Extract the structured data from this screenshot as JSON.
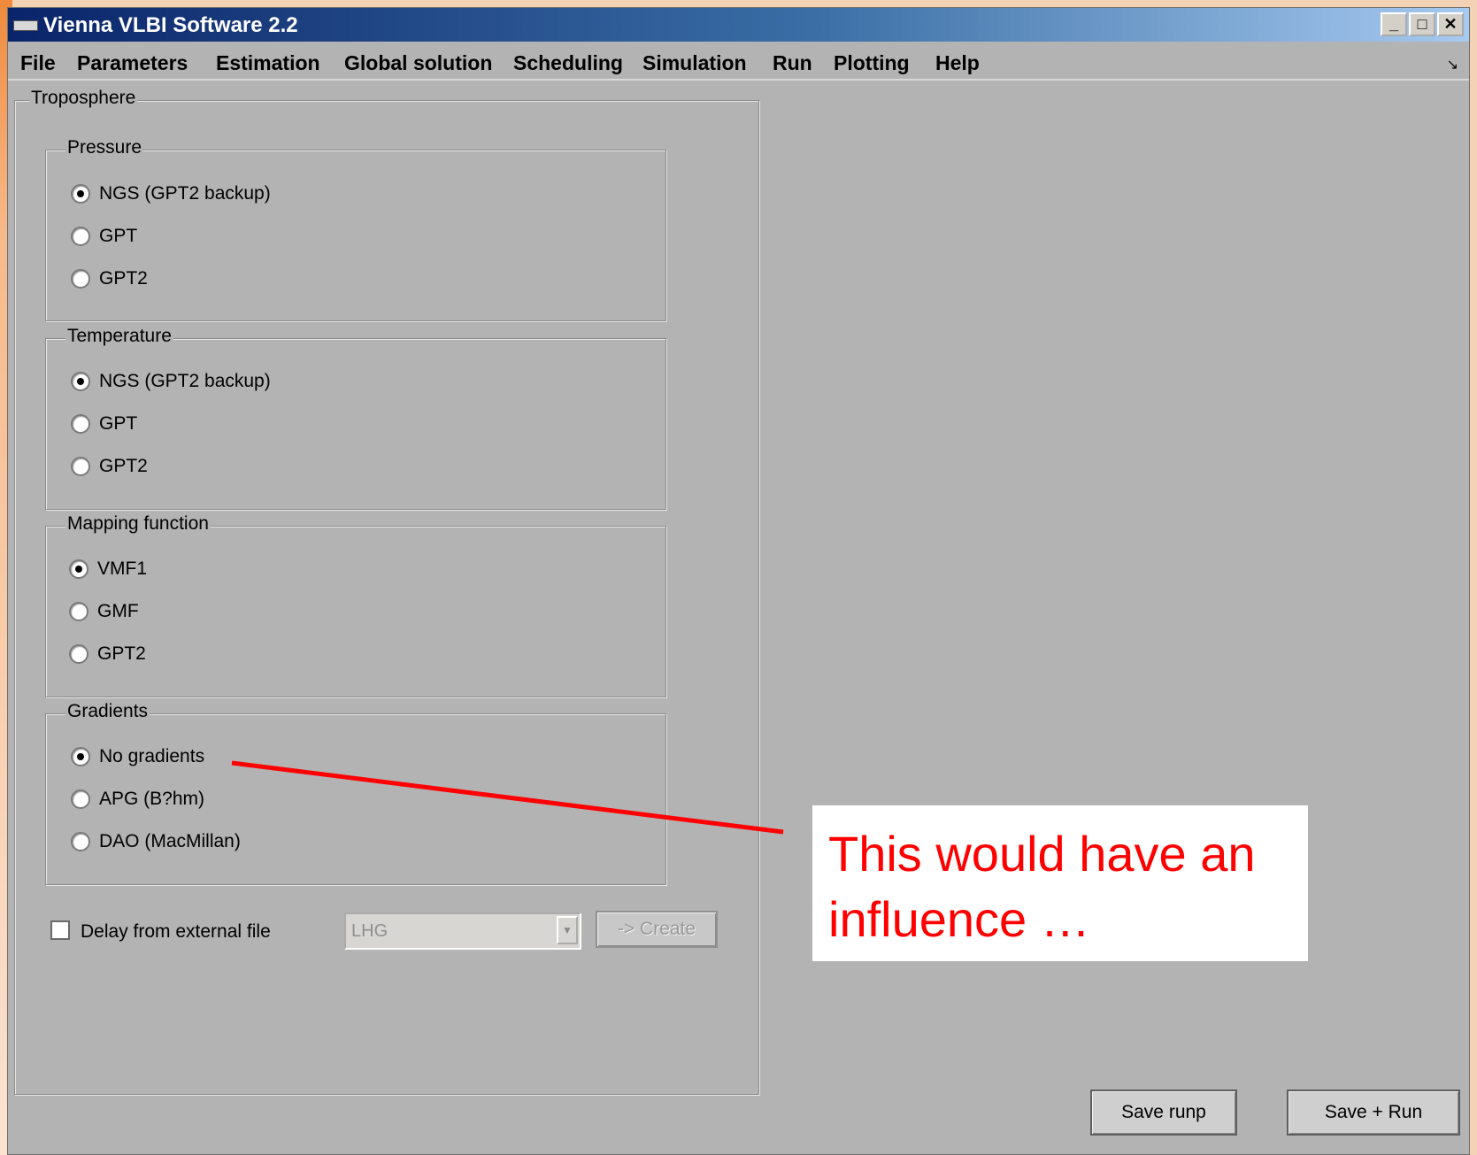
{
  "window": {
    "title": "Vienna VLBI Software 2.2",
    "controls": {
      "minimize": "_",
      "maximize": "□",
      "close": "✕"
    }
  },
  "menu": {
    "items": [
      "File",
      "Parameters",
      "Estimation",
      "Global solution",
      "Scheduling",
      "Simulation",
      "Run",
      "Plotting",
      "Help"
    ],
    "corner_glyph": "↘"
  },
  "troposphere": {
    "title": "Troposphere",
    "pressure": {
      "title": "Pressure",
      "options": [
        "NGS (GPT2 backup)",
        "GPT",
        "GPT2"
      ],
      "selected": 0
    },
    "temperature": {
      "title": "Temperature",
      "options": [
        "NGS (GPT2 backup)",
        "GPT",
        "GPT2"
      ],
      "selected": 0
    },
    "mapping": {
      "title": "Mapping function",
      "options": [
        "VMF1",
        "GMF",
        "GPT2"
      ],
      "selected": 0
    },
    "gradients": {
      "title": "Gradients",
      "options": [
        "No gradients",
        "APG (B?hm)",
        "DAO (MacMillan)"
      ],
      "selected": 0
    },
    "delay_external": {
      "label": "Delay from external file",
      "checked": false
    },
    "delay_source": {
      "value": "LHG"
    },
    "create_button": "-> Create"
  },
  "buttons": {
    "save_runp": "Save runp",
    "save_run": "Save + Run"
  },
  "callout": {
    "text": "This would have an influence …",
    "color": "#ff0000"
  }
}
